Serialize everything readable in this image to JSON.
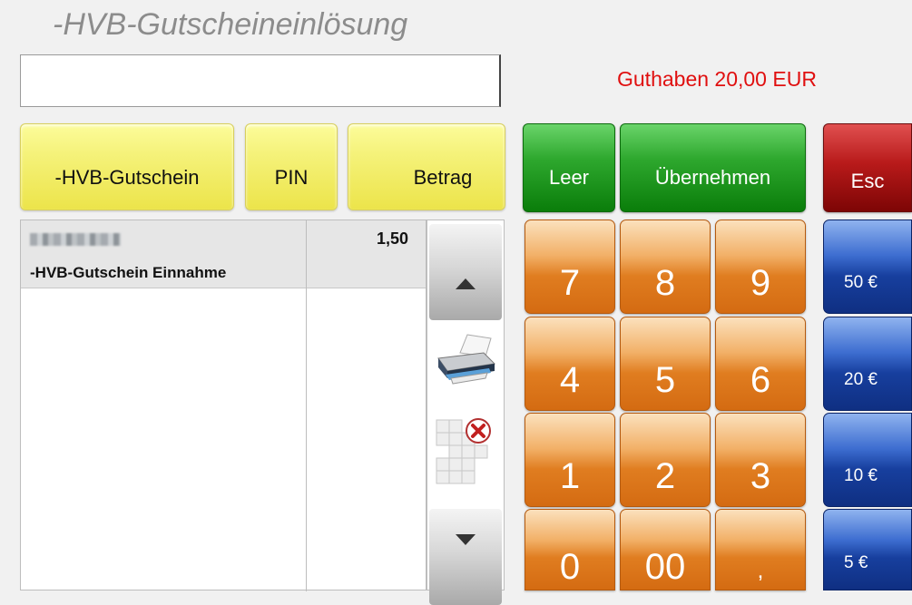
{
  "title": "-HVB-Gutscheineinlösung",
  "input": {
    "value": ""
  },
  "balance": "Guthaben 20,00 EUR",
  "mode_buttons": {
    "voucher": "-HVB-Gutschein",
    "pin": "PIN",
    "amount": "Betrag"
  },
  "action_buttons": {
    "clear": "Leer",
    "apply": "Übernehmen",
    "esc": "Esc"
  },
  "list": {
    "items": [
      {
        "name": "-HVB-Gutschein Einnahme",
        "price": "1,50"
      }
    ]
  },
  "keypad": {
    "k7": "7",
    "k8": "8",
    "k9": "9",
    "k4": "4",
    "k5": "5",
    "k6": "6",
    "k1": "1",
    "k2": "2",
    "k3": "3",
    "k0": "0",
    "k00": "00",
    "kcomma": ","
  },
  "quick_amounts": {
    "a50": "50 €",
    "a20": "20 €",
    "a10": "10 €",
    "a5": "5 €"
  },
  "icons": {
    "scroll_up": "triangle-up-icon",
    "print": "printer-icon",
    "delete": "grid-delete-icon",
    "scroll_down": "triangle-down-icon"
  },
  "colors": {
    "balance_text": "#e01010",
    "yellow_button": "#f5f27a",
    "green_button": "#2ea82e",
    "red_button": "#b81a1a",
    "orange_key": "#e07d20",
    "blue_key": "#173f9e"
  }
}
